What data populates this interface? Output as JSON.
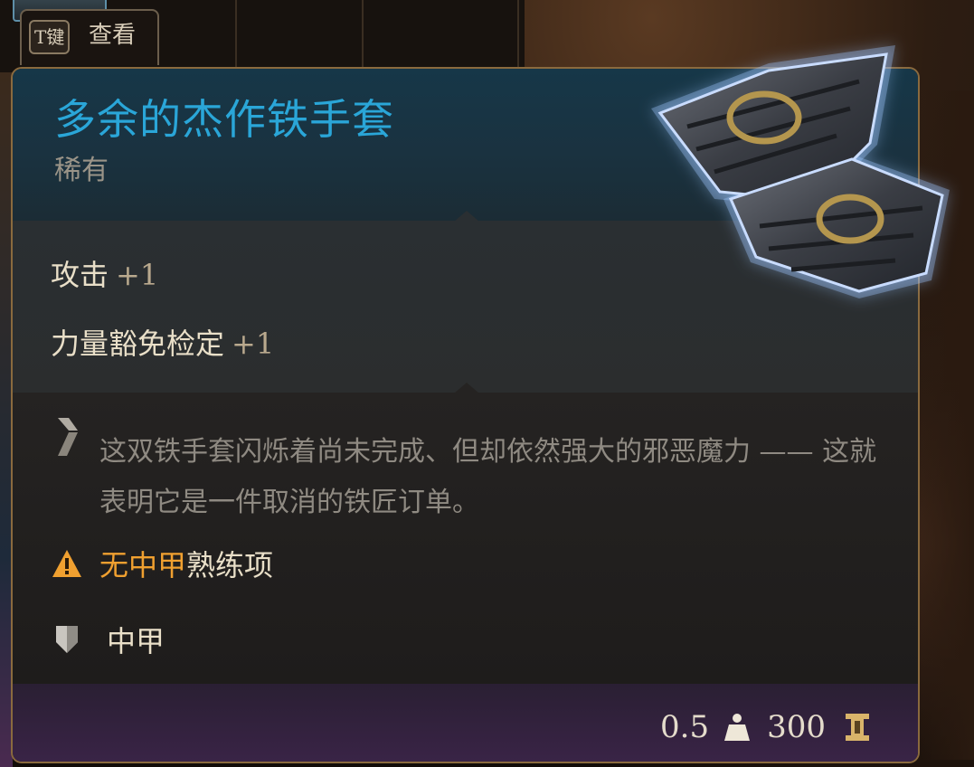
{
  "inspect_hint": {
    "key": "T键",
    "label": "查看"
  },
  "item": {
    "name": "多余的杰作铁手套",
    "rarity": "稀有",
    "name_color": "#2aa6d8",
    "icon": "gauntlets-icon"
  },
  "stats": [
    {
      "label": "攻击",
      "bonus": "+1"
    },
    {
      "label": "力量豁免检定",
      "bonus": "+1"
    }
  ],
  "description": {
    "icon": "description-icon",
    "text": "这双铁手套闪烁着尚未完成、但却依然强大的邪恶魔力 —— 这就表明它是一件取消的铁匠订单。"
  },
  "warning": {
    "icon": "warning-icon",
    "highlight": "无中甲",
    "rest": "熟练项",
    "highlight_color": "#f0a030"
  },
  "armor_type": {
    "icon": "armor-shield-icon",
    "label": "中甲"
  },
  "footer": {
    "weight": "0.5",
    "weight_icon": "weight-icon",
    "value": "300",
    "value_icon": "gold-icon"
  }
}
